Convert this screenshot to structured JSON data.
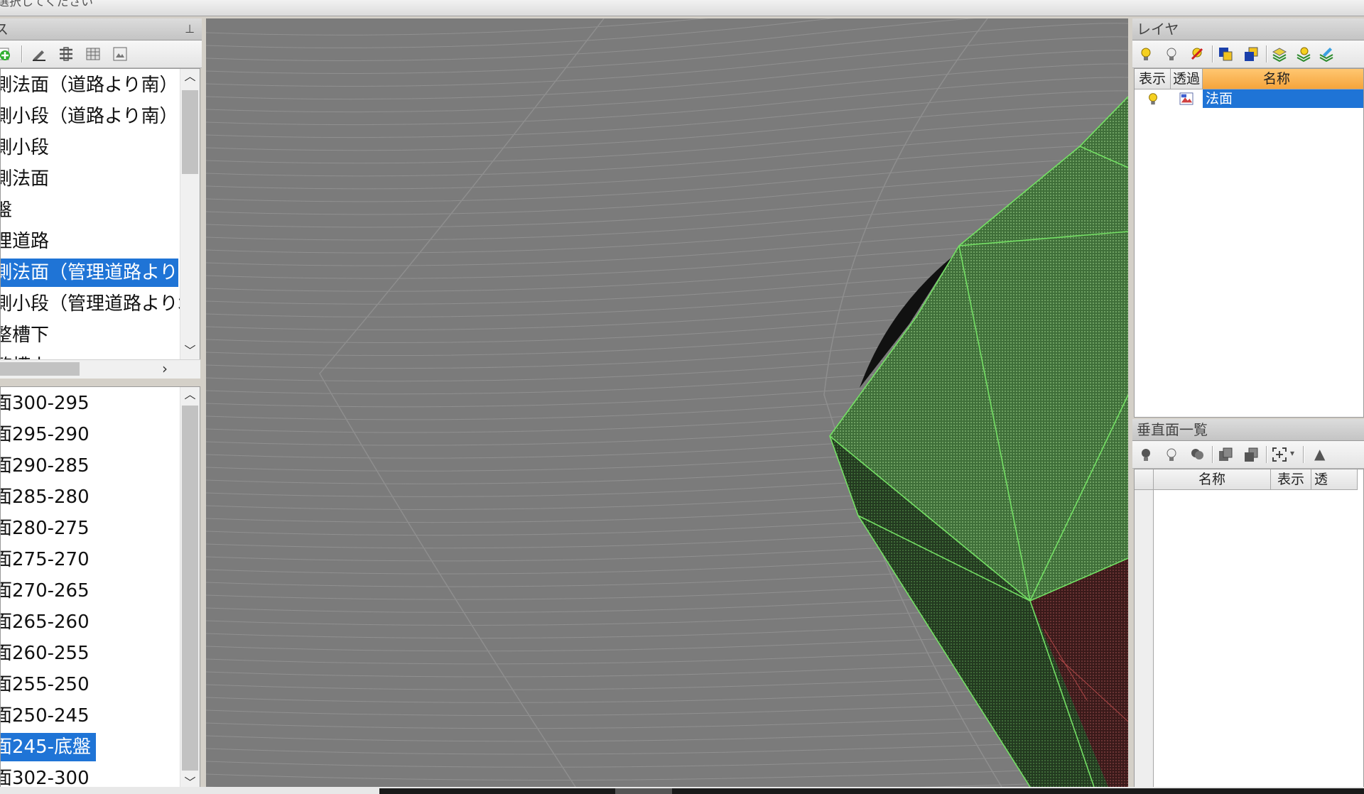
{
  "window": {
    "status_text": "選択してください"
  },
  "left_panel": {
    "header_title": "ス",
    "pin_icon": "pin-icon",
    "toolbar_icons": [
      "add-icon",
      "edit-icon",
      "list-icon",
      "table-icon",
      "image-icon"
    ],
    "upper_list": [
      {
        "label": "側法面（道路より南）",
        "selected": false
      },
      {
        "label": "側小段（道路より南）",
        "selected": false
      },
      {
        "label": "側小段",
        "selected": false
      },
      {
        "label": "側法面",
        "selected": false
      },
      {
        "label": "盤",
        "selected": false
      },
      {
        "label": "理道路",
        "selected": false
      },
      {
        "label": "側法面（管理道路より北）",
        "selected": true
      },
      {
        "label": "側小段（管理道路より北）",
        "selected": false
      },
      {
        "label": "整槽下",
        "selected": false
      },
      {
        "label": "整槽上",
        "selected": false
      }
    ],
    "lower_list": [
      {
        "label": "面300-295",
        "selected": false
      },
      {
        "label": "面295-290",
        "selected": false
      },
      {
        "label": "面290-285",
        "selected": false
      },
      {
        "label": "面285-280",
        "selected": false
      },
      {
        "label": "面280-275",
        "selected": false
      },
      {
        "label": "面275-270",
        "selected": false
      },
      {
        "label": "面270-265",
        "selected": false
      },
      {
        "label": "面265-260",
        "selected": false
      },
      {
        "label": "面260-255",
        "selected": false
      },
      {
        "label": "面255-250",
        "selected": false
      },
      {
        "label": "面250-245",
        "selected": false
      },
      {
        "label": "面245-底盤",
        "selected": true
      },
      {
        "label": "面302-300",
        "selected": false
      }
    ]
  },
  "layer_panel": {
    "title": "レイヤ",
    "toolbar_icons": [
      "bulb-on-icon",
      "bulb-off-icon",
      "bulb-toggle-icon",
      "layer-copy-icon",
      "layer-paste-icon",
      "layers-icon",
      "layers-light-icon",
      "layers-edit-icon"
    ],
    "columns": {
      "show": "表示",
      "transparent": "透過",
      "name": "名称"
    },
    "rows": [
      {
        "name": "法面",
        "show_icon": "bulb-on-icon",
        "transparent_icon": "layer-image-icon",
        "selected": true
      }
    ]
  },
  "vertical_panel": {
    "title": "垂直面一覧",
    "toolbar_icons": [
      "bulb-on-icon",
      "bulb-off-icon",
      "bulb-toggle-icon",
      "copy-icon",
      "paste-icon",
      "fit-icon",
      "dropdown-icon",
      "up-icon"
    ],
    "columns": {
      "name": "名称",
      "show": "表示",
      "transparent": "透"
    }
  },
  "colors": {
    "selection": "#1f74d6",
    "surface_green": "#4f7d45",
    "surface_red": "#4a2424",
    "viewport_bg": "#7b7b7b"
  }
}
